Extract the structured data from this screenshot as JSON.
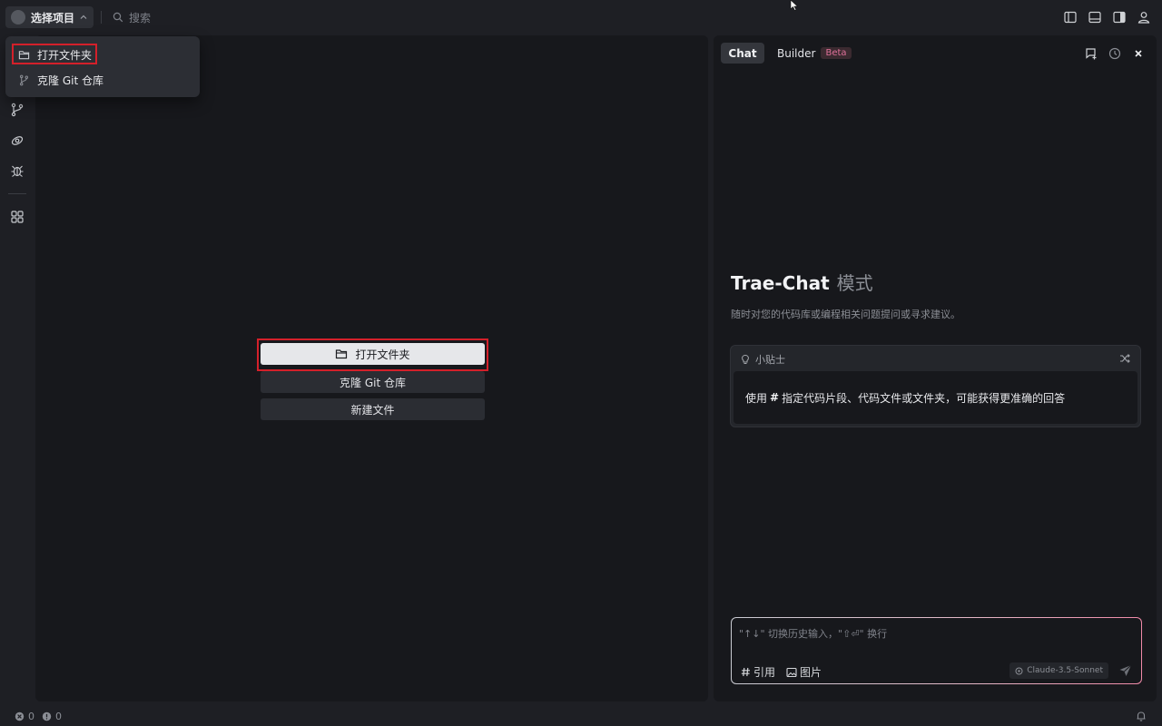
{
  "topbar": {
    "project_label": "选择项目",
    "search_placeholder": "搜索",
    "icons": [
      "sidebar-left-icon",
      "panel-bottom-icon",
      "sidebar-right-icon",
      "account-icon"
    ]
  },
  "activitybar": {
    "icons": [
      "source-control-icon",
      "remote-link-icon",
      "debug-icon",
      "extensions-icon"
    ]
  },
  "dropdown": {
    "items": [
      {
        "label": "打开文件夹",
        "icon": "folder-icon"
      },
      {
        "label": "克隆 Git 仓库",
        "icon": "git-branch-icon"
      }
    ]
  },
  "editor": {
    "buttons": [
      {
        "label": "打开文件夹",
        "icon": "folder-icon"
      },
      {
        "label": "克隆 Git 仓库"
      },
      {
        "label": "新建文件"
      }
    ]
  },
  "chat": {
    "tabs": {
      "chat": "Chat",
      "builder": "Builder",
      "beta": "Beta"
    },
    "title_strong": "Trae-Chat",
    "title_mode": "模式",
    "subtitle": "随时对您的代码库或编程相关问题提问或寻求建议。",
    "tip": {
      "header": "小贴士",
      "body_prefix": "使用",
      "body_hash": "#",
      "body_suffix": "指定代码片段、代码文件或文件夹，可能获得更准确的回答"
    },
    "input": {
      "placeholder": "\"↑↓\" 切换历史输入，\"⇧⏎\" 换行",
      "reference_label": "引用",
      "image_label": "图片",
      "model": "Claude-3.5-Sonnet"
    }
  },
  "statusbar": {
    "errors": "0",
    "warnings": "0"
  },
  "colors": {
    "highlight": "#d4202a",
    "beta_badge": "#e0719a"
  }
}
